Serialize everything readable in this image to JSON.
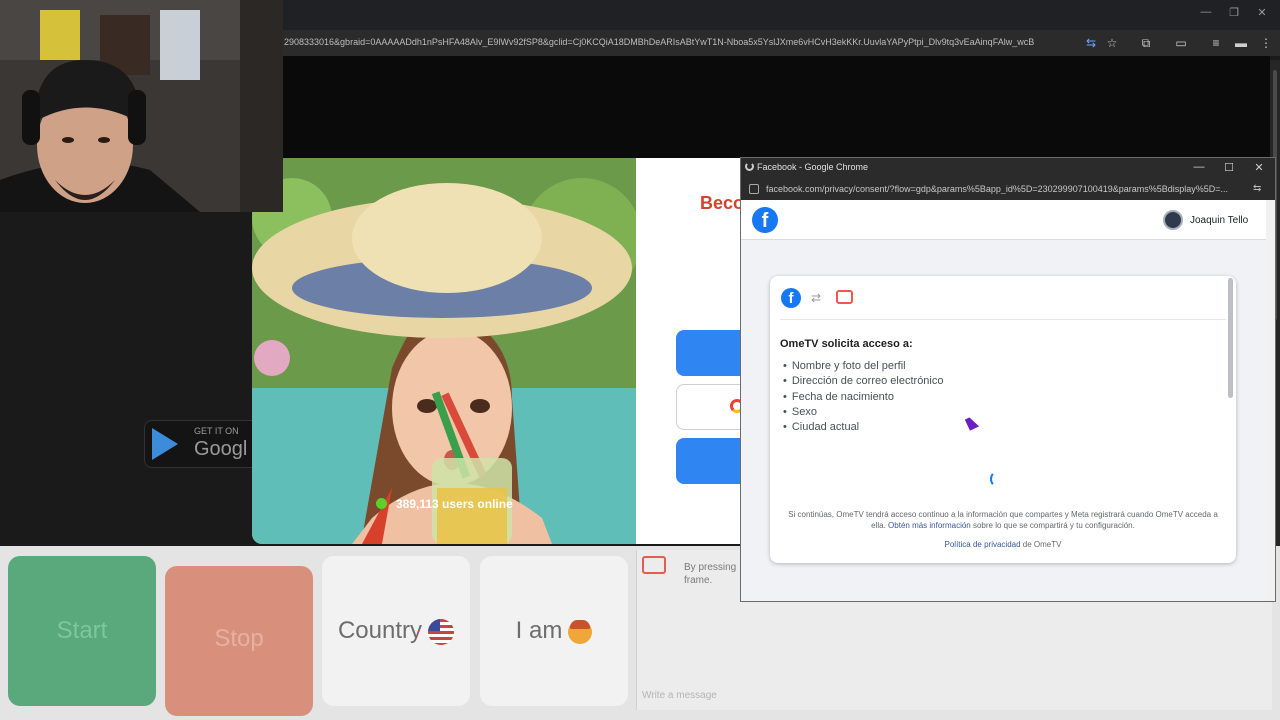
{
  "browser": {
    "url": "2908333016&gbraid=0AAAAADdh1nPsHFA48Alv_E9lWv92fSP8&gclid=Cj0KCQiA18DMBhDeARIsABtYwT1N-Nboa5x5YslJXme6vHCvH3ekKKr.UuvlaYAPyPtpi_Dlv9tq3vEaAinqFAlw_wcB",
    "toolbar_icons": [
      "translate-icon",
      "star-icon",
      "extensions-icon",
      "cast-icon",
      "playlist-icon",
      "profile-icon",
      "menu-icon"
    ]
  },
  "ad": {
    "users_online": "389,113 users online",
    "become_title": "Beco",
    "google_play_small": "GET IT ON",
    "google_play_big": "Googl"
  },
  "controls": {
    "start": "Start",
    "stop": "Stop",
    "country": "Country",
    "iam": "I am"
  },
  "chat": {
    "notice": "By pressing frame.",
    "input_placeholder": "Write a message"
  },
  "popup": {
    "title": "Facebook - Google Chrome",
    "url": "facebook.com/privacy/consent/?flow=gdp&params%5Bapp_id%5D=230299907100419&params%5Bdisplay%5D=...",
    "user_name": "Joaquin Tello",
    "heading": "OmeTV solicita acceso a:",
    "permissions": [
      "Nombre y foto del perfil",
      "Dirección de correo electrónico",
      "Fecha de nacimiento",
      "Sexo",
      "Ciudad actual"
    ],
    "disclaimer_pre": "Si continúas, OmeTV tendrá acceso continuo a la información que compartes y Meta registrará cuando OmeTV acceda a ella.",
    "disclaimer_link": "Obtén más información",
    "disclaimer_post": "sobre lo que se compartirá y tu configuración.",
    "policy_link": "Política de privacidad",
    "policy_post": "de OmeTV"
  },
  "colors": {
    "facebook_blue": "#1877f2",
    "online_green": "#5ad22b",
    "start_green": "#5aa97c",
    "stop_salmon": "#d8907c",
    "ometv_red": "#d7402b"
  }
}
